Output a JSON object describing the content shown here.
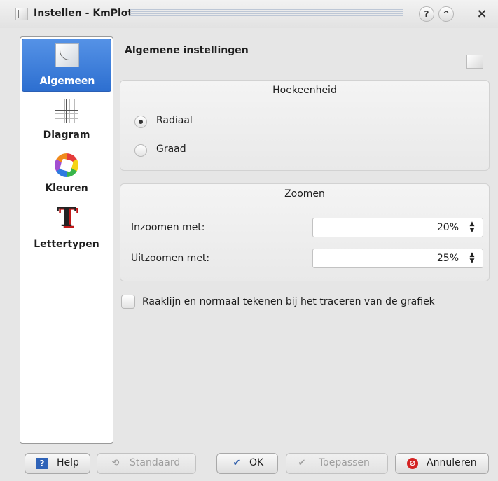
{
  "window": {
    "title": "Instellen - KmPlot",
    "help_button": "?",
    "up_button": "^",
    "close_button": "×"
  },
  "sidebar": {
    "items": [
      {
        "label": "Algemeen",
        "icon": "fx-icon",
        "active": true
      },
      {
        "label": "Diagram",
        "icon": "grid-icon",
        "active": false
      },
      {
        "label": "Kleuren",
        "icon": "colors-icon",
        "active": false
      },
      {
        "label": "Lettertypen",
        "icon": "font-icon",
        "active": false
      }
    ]
  },
  "main": {
    "header": "Algemene instellingen",
    "angle_group": {
      "title": "Hoekeenheid",
      "options": [
        {
          "label": "Radiaal",
          "checked": true
        },
        {
          "label": "Graad",
          "checked": false
        }
      ]
    },
    "zoom_group": {
      "title": "Zoomen",
      "zoom_in": {
        "label": "Inzoomen met:",
        "value": "20%"
      },
      "zoom_out": {
        "label": "Uitzoomen met:",
        "value": "25%"
      }
    },
    "tangent_checkbox": {
      "label": "Raaklijn en normaal tekenen bij het traceren van de grafiek",
      "checked": false
    }
  },
  "buttons": {
    "help": "Help",
    "standaard": "Standaard",
    "ok": "OK",
    "toepassen": "Toepassen",
    "annuleren": "Annuleren"
  },
  "colors": {
    "accent": "#3a7bd9",
    "background": "#e6e6e6"
  }
}
